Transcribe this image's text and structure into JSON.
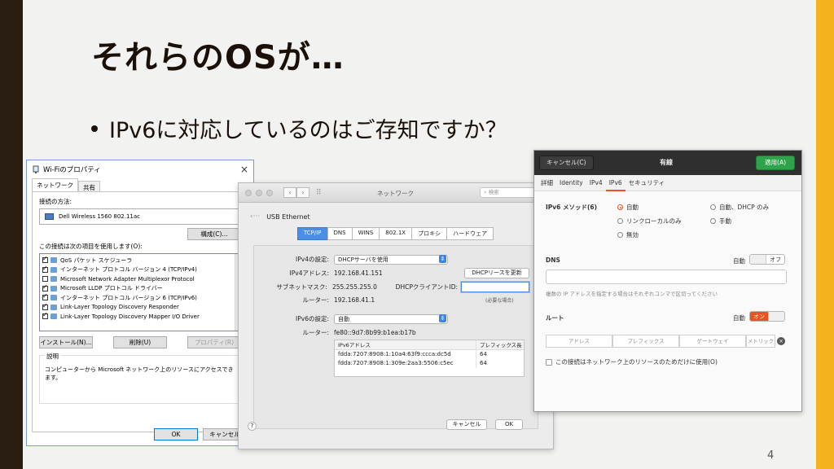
{
  "slide": {
    "title": "それらのOSが…",
    "bullet": "IPv6に対応しているのはご存知ですか？",
    "page_number": "4"
  },
  "windows_dialog": {
    "title": "Wi-Fiのプロパティ",
    "close": "×",
    "tabs": [
      "ネットワーク",
      "共有"
    ],
    "connect_method_label": "接続の方法:",
    "adapter": "Dell Wireless 1560 802.11ac",
    "configure_button": "構成(C)...",
    "items_label": "この接続は次の項目を使用します(O):",
    "items": [
      {
        "checked": true,
        "label": "QoS パケット スケジューラ"
      },
      {
        "checked": true,
        "label": "インターネット プロトコル バージョン 4 (TCP/IPv4)"
      },
      {
        "checked": false,
        "label": "Microsoft Network Adapter Multiplexor Protocol"
      },
      {
        "checked": true,
        "label": "Microsoft LLDP プロトコル ドライバー"
      },
      {
        "checked": true,
        "label": "インターネット プロトコル バージョン 6 (TCP/IPv6)"
      },
      {
        "checked": true,
        "label": "Link-Layer Topology Discovery Responder"
      },
      {
        "checked": true,
        "label": "Link-Layer Topology Discovery Mapper I/O Driver"
      }
    ],
    "install_button": "インストール(N)...",
    "uninstall_button": "削除(U)",
    "properties_button": "プロパティ(R)",
    "description_title": "説明",
    "description_text": "コンピューターから Microsoft ネットワーク上のリソースにアクセスできます。",
    "ok_button": "OK",
    "cancel_button": "キャンセル"
  },
  "mac_window": {
    "title": "ネットワーク",
    "search_placeholder": "検索",
    "interface": "USB Ethernet",
    "tabs": [
      "TCP/IP",
      "DNS",
      "WINS",
      "802.1X",
      "プロキシ",
      "ハードウェア"
    ],
    "ipv4_config_label": "IPv4の設定:",
    "ipv4_config_value": "DHCPサーバを使用",
    "ipv4_address_label": "IPv4アドレス:",
    "ipv4_address": "192.168.41.151",
    "renew_dhcp_button": "DHCPリースを更新",
    "subnet_label": "サブネットマスク:",
    "subnet": "255.255.255.0",
    "dhcp_client_id_label": "DHCPクライアントID:",
    "dhcp_client_id_hint": "(必要な場合)",
    "router_label": "ルーター:",
    "router": "192.168.41.1",
    "ipv6_config_label": "IPv6の設定:",
    "ipv6_config_value": "自動",
    "router6_label": "ルーター:",
    "router6": "fe80::9d7:8b99:b1ea:b17b",
    "ipv6_table_headers": [
      "IPv6アドレス",
      "プレフィックス長"
    ],
    "ipv6_rows": [
      {
        "address": "fdda:7207:8908:1:10a4:63f9:ccca:dc5d",
        "prefix": "64"
      },
      {
        "address": "fdda:7207:8908:1:309e:2aa3:5506:c5ec",
        "prefix": "64"
      }
    ],
    "help": "?",
    "cancel_button": "キャンセル",
    "ok_button": "OK"
  },
  "ubuntu_dialog": {
    "cancel_button": "キャンセル(C)",
    "title": "有線",
    "apply_button": "適用(A)",
    "tabs": [
      "詳細",
      "Identity",
      "IPv4",
      "IPv6",
      "セキュリティ"
    ],
    "active_tab": "IPv6",
    "method_label": "IPv6 メソッド(6)",
    "methods": {
      "auto": "自動",
      "auto_dhcp": "自動、DHCP のみ",
      "link_local": "リンクローカルのみ",
      "manual": "手動",
      "disabled": "無効"
    },
    "selected_method": "自動",
    "dns_label": "DNS",
    "dns_auto_label": "自動",
    "dns_switch": "オフ",
    "dns_hint": "複数の IP アドレスを指定する場合はそれぞれコンマで区切ってください",
    "routes_label": "ルート",
    "routes_auto_label": "自動",
    "routes_switch": "オン",
    "route_columns": [
      "アドレス",
      "プレフィックス",
      "ゲートウェイ",
      "メトリック"
    ],
    "local_only_label": "この接続はネットワーク上のリソースのためだけに使用(O)"
  }
}
